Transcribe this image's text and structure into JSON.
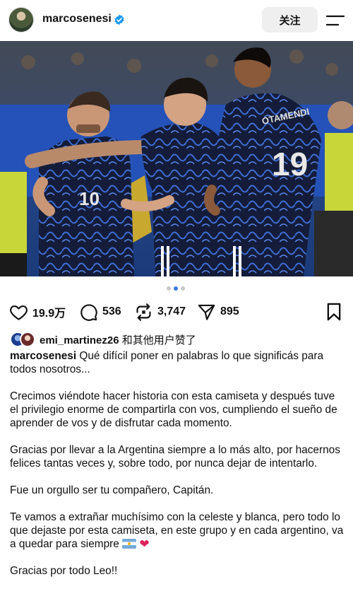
{
  "header": {
    "username": "marcosenesi",
    "follow_label": "关注"
  },
  "post": {
    "carousel": {
      "count": 3,
      "active": 2
    }
  },
  "actions": {
    "likes": "19.9万",
    "comments": "536",
    "reposts": "3,747",
    "shares": "895"
  },
  "liked_by": {
    "user": "emi_martinez26",
    "suffix": " 和其他用户赞了"
  },
  "caption": {
    "author": "marcosenesi",
    "lines": [
      "Qué difícil poner en palabras lo que significás para todos nosotros...",
      "Crecimos viéndote hacer historia con esta camiseta y después tuve el privilegio enorme de compartirla con vos, cumpliendo el sueño de aprender de vos y de disfrutar cada momento.",
      "Gracias por llevar a la Argentina siempre a lo más alto, por hacernos felices tantas veces y, sobre todo, por nunca dejar de intentarlo.",
      "Fue un orgullo ser tu compañero, Capitán.",
      "Te vamos a extrañar muchísimo con la celeste y blanca, pero todo lo que dejaste por esta camiseta, en este grupo y en cada argentino, va a quedar para siempre",
      "Gracias por todo Leo!!"
    ]
  },
  "icons": {
    "verified": "verified-badge-icon",
    "menu": "menu-icon",
    "like": "heart-icon",
    "comment": "comment-icon",
    "repost": "repost-icon",
    "share": "send-icon",
    "save": "bookmark-icon"
  },
  "colors": {
    "verified_blue": "#1d9bf0",
    "dot_active": "#3a78e0",
    "follow_bg": "#efefef"
  }
}
